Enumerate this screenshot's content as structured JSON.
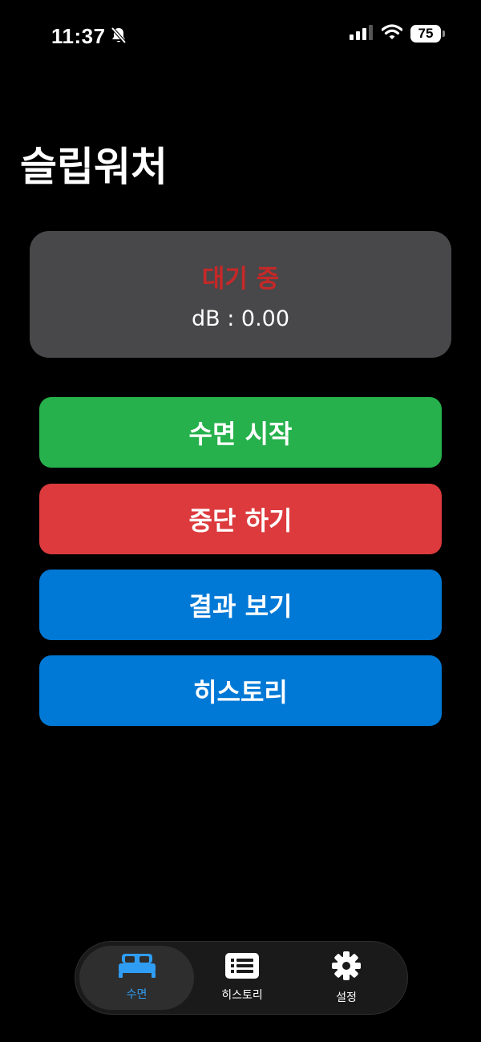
{
  "status_bar": {
    "time": "11:37",
    "battery": "75"
  },
  "app": {
    "title": "슬립워처"
  },
  "status_card": {
    "state": "대기 중",
    "db_reading": "dB : 0.00"
  },
  "actions": {
    "start_sleep": "수면 시작",
    "stop": "중단 하기",
    "view_results": "결과 보기",
    "history": "히스토리"
  },
  "tab_bar": {
    "tabs": [
      {
        "label": "수면",
        "icon": "bed-icon",
        "selected": true
      },
      {
        "label": "히스토리",
        "icon": "list-icon",
        "selected": false
      },
      {
        "label": "설정",
        "icon": "gear-icon",
        "selected": false
      }
    ]
  },
  "colors": {
    "status_text": "#c62828",
    "start_button": "#26b14c",
    "stop_button": "#dc3a3d",
    "primary_button": "#0079d6",
    "selected_tab": "#2f9df4"
  }
}
